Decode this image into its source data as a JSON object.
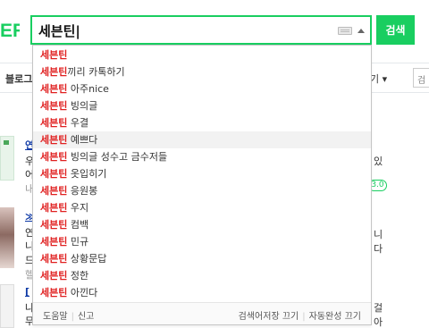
{
  "header": {
    "logo_fragment": "ER",
    "search": {
      "value": "세븐틴|",
      "button_label": "검색"
    }
  },
  "nav": {
    "tab_blog": "블로그",
    "tab_right": "기 ▾",
    "mini_search": "검"
  },
  "results_bg": {
    "left": [
      {
        "text": "연",
        "style": "blue"
      },
      {
        "text": "우",
        "style": "plain"
      },
      {
        "text": "어",
        "style": "plain"
      },
      {
        "text": "내",
        "style": "gray"
      },
      {
        "text": "≫",
        "style": "blue"
      },
      {
        "text": "연",
        "style": "plain"
      },
      {
        "text": "니",
        "style": "plain"
      },
      {
        "text": "드",
        "style": "plain"
      },
      {
        "text": "헬",
        "style": "gray"
      },
      {
        "text": "[",
        "style": "blue"
      },
      {
        "text": "나",
        "style": "plain"
      },
      {
        "text": "무",
        "style": "plain"
      }
    ],
    "right": [
      {
        "text": "있"
      },
      {
        "text": "니"
      },
      {
        "text": "다"
      },
      {
        "text": "걸"
      },
      {
        "text": "아"
      }
    ],
    "badge": "3.0"
  },
  "autocomplete": {
    "query": "세븐틴",
    "items": [
      {
        "rest": ""
      },
      {
        "rest": "끼리 카톡하기"
      },
      {
        "rest": " 아주nice"
      },
      {
        "rest": " 빙의글"
      },
      {
        "rest": " 우결"
      },
      {
        "rest": " 예쁘다",
        "highlighted": true
      },
      {
        "rest": " 빙의글 성수고 금수저들"
      },
      {
        "rest": " 옷입히기"
      },
      {
        "rest": " 응원봉"
      },
      {
        "rest": " 우지"
      },
      {
        "rest": " 컴백"
      },
      {
        "rest": " 민규"
      },
      {
        "rest": " 상황문답"
      },
      {
        "rest": " 정한"
      },
      {
        "rest": " 아낀다"
      }
    ],
    "footer": {
      "help": "도움말",
      "report": "신고",
      "save_off": "검색어저장 끄기",
      "auto_off": "자동완성 끄기"
    }
  },
  "colors": {
    "brand_green": "#19ce60",
    "query_red": "#e02020"
  },
  "icons": {
    "keyboard": "keyboard-icon",
    "dropdown": "caret-up-icon"
  }
}
